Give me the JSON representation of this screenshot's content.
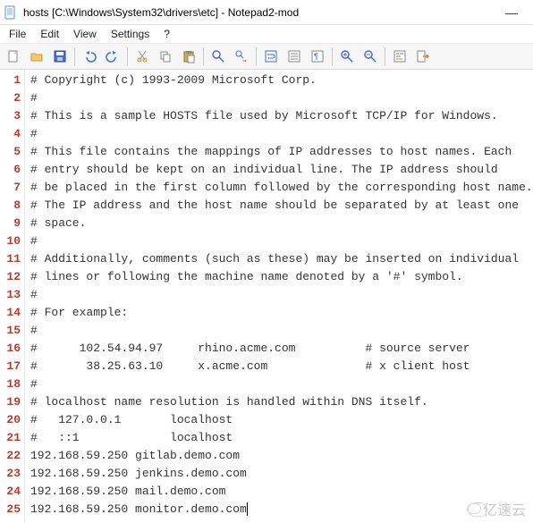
{
  "window": {
    "title": "hosts [C:\\Windows\\System32\\drivers\\etc] - Notepad2-mod",
    "minimize_glyph": "—"
  },
  "menubar": {
    "items": [
      "File",
      "Edit",
      "View",
      "Settings",
      "?"
    ]
  },
  "toolbar": {
    "icons": [
      "new-file-icon",
      "open-folder-icon",
      "save-icon",
      "sep",
      "undo-icon",
      "redo-icon",
      "sep",
      "cut-icon",
      "copy-icon",
      "paste-icon",
      "sep",
      "find-icon",
      "replace-icon",
      "sep",
      "word-wrap-icon",
      "line-numbers-icon",
      "whitespace-icon",
      "sep",
      "zoom-in-icon",
      "zoom-out-icon",
      "sep",
      "syntax-icon",
      "exit-icon"
    ]
  },
  "watermark": {
    "text": "亿速云"
  },
  "editor": {
    "lines": [
      "# Copyright (c) 1993-2009 Microsoft Corp.",
      "#",
      "# This is a sample HOSTS file used by Microsoft TCP/IP for Windows.",
      "#",
      "# This file contains the mappings of IP addresses to host names. Each",
      "# entry should be kept on an individual line. The IP address should",
      "# be placed in the first column followed by the corresponding host name.",
      "# The IP address and the host name should be separated by at least one",
      "# space.",
      "#",
      "# Additionally, comments (such as these) may be inserted on individual",
      "# lines or following the machine name denoted by a '#' symbol.",
      "#",
      "# For example:",
      "#",
      "#      102.54.94.97     rhino.acme.com          # source server",
      "#       38.25.63.10     x.acme.com              # x client host",
      "#",
      "# localhost name resolution is handled within DNS itself.",
      "#   127.0.0.1       localhost",
      "#   ::1             localhost",
      "192.168.59.250 gitlab.demo.com",
      "192.168.59.250 jenkins.demo.com",
      "192.168.59.250 mail.demo.com",
      "192.168.59.250 monitor.demo.com"
    ],
    "cursor_line": 25
  }
}
